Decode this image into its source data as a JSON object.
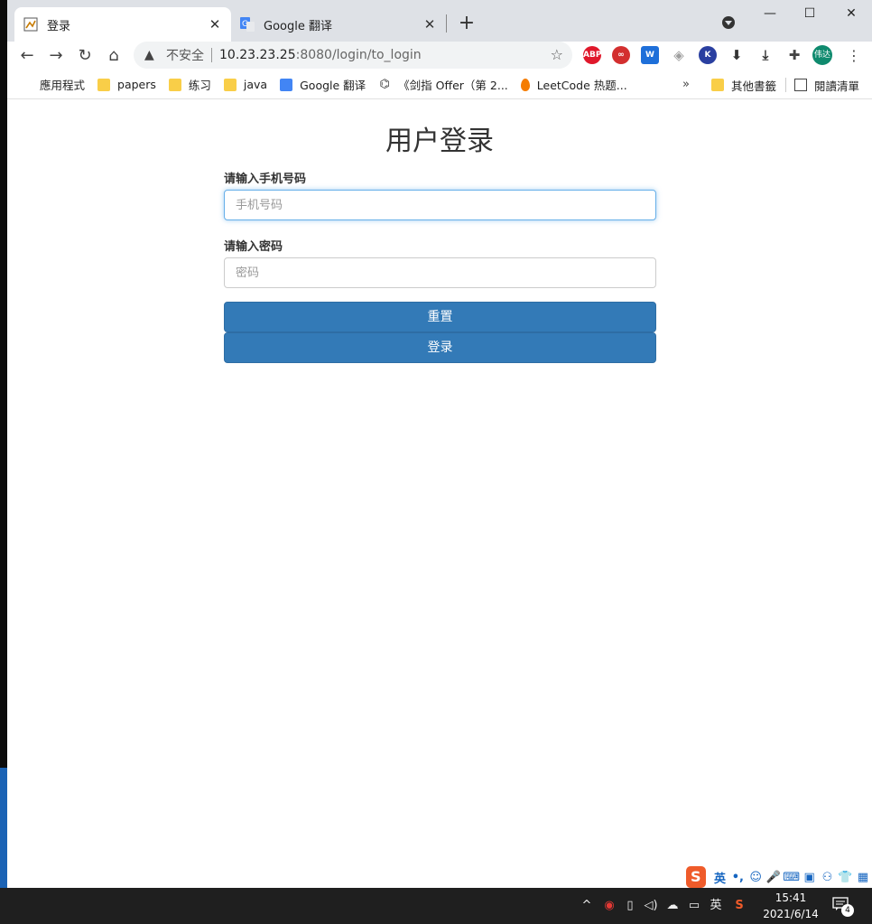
{
  "window": {
    "minimize": "—",
    "maximize": "☐",
    "close": "✕"
  },
  "tabs": [
    {
      "title": "登录",
      "close": "✕",
      "icon": "page-favicon"
    },
    {
      "title": "Google 翻译",
      "close": "✕",
      "icon": "google-translate-favicon"
    }
  ],
  "new_tab": "+",
  "toolbar": {
    "back": "←",
    "forward": "→",
    "reload": "↻",
    "home": "⌂",
    "security_icon": "▲",
    "security_text": "不安全",
    "url_host": "10.23.23.25",
    "url_path": ":8080/login/to_login",
    "bookmark_star": "☆",
    "extensions": [
      {
        "name": "abp",
        "label": "ABP",
        "color": "#e0182b"
      },
      {
        "name": "ext-red-circle",
        "label": "∞",
        "color": "#d32f2f"
      },
      {
        "name": "ext-w",
        "label": "W",
        "color": "#1e6fd9"
      },
      {
        "name": "ext-shield",
        "label": "◈",
        "color": "#9e9e9e"
      },
      {
        "name": "ext-k",
        "label": "K",
        "color": "#2a3fa0"
      },
      {
        "name": "ext-download-arrow",
        "label": "⬇",
        "color": "#333333"
      },
      {
        "name": "ext-download",
        "label": "⤓",
        "color": "#333333"
      },
      {
        "name": "extensions-puzzle",
        "label": "✚",
        "color": "#444444"
      }
    ],
    "avatar": "伟达",
    "menu": "⋮"
  },
  "bookmarks": {
    "items": [
      {
        "label": "應用程式",
        "icon": "apps-grid"
      },
      {
        "label": "papers",
        "icon": "folder"
      },
      {
        "label": "练习",
        "icon": "folder"
      },
      {
        "label": "java",
        "icon": "folder"
      },
      {
        "label": "Google 翻译",
        "icon": "google-translate"
      },
      {
        "label": "《剑指 Offer（第 2...",
        "icon": "leetcode"
      },
      {
        "label": "LeetCode 热题...",
        "icon": "leetcode-flame"
      }
    ],
    "more": "»",
    "other": "其他書籤",
    "reading_list": "閱讀清單"
  },
  "page": {
    "title": "用户登录",
    "phone_label": "请输入手机号码",
    "phone_placeholder": "手机号码",
    "password_label": "请输入密码",
    "password_placeholder": "密码",
    "reset_button": "重置",
    "login_button": "登录"
  },
  "ime": {
    "logo": "S",
    "items": [
      "英",
      "•,",
      "☺",
      "🎤",
      "⌨",
      "▣",
      "⚇",
      "👕",
      "▦"
    ]
  },
  "taskbar": {
    "tray": [
      "^",
      "◉",
      "▯",
      "◁)",
      "☁",
      "▭",
      "英",
      "S"
    ],
    "time": "15:41",
    "date": "2021/6/14",
    "notifications": "4"
  }
}
